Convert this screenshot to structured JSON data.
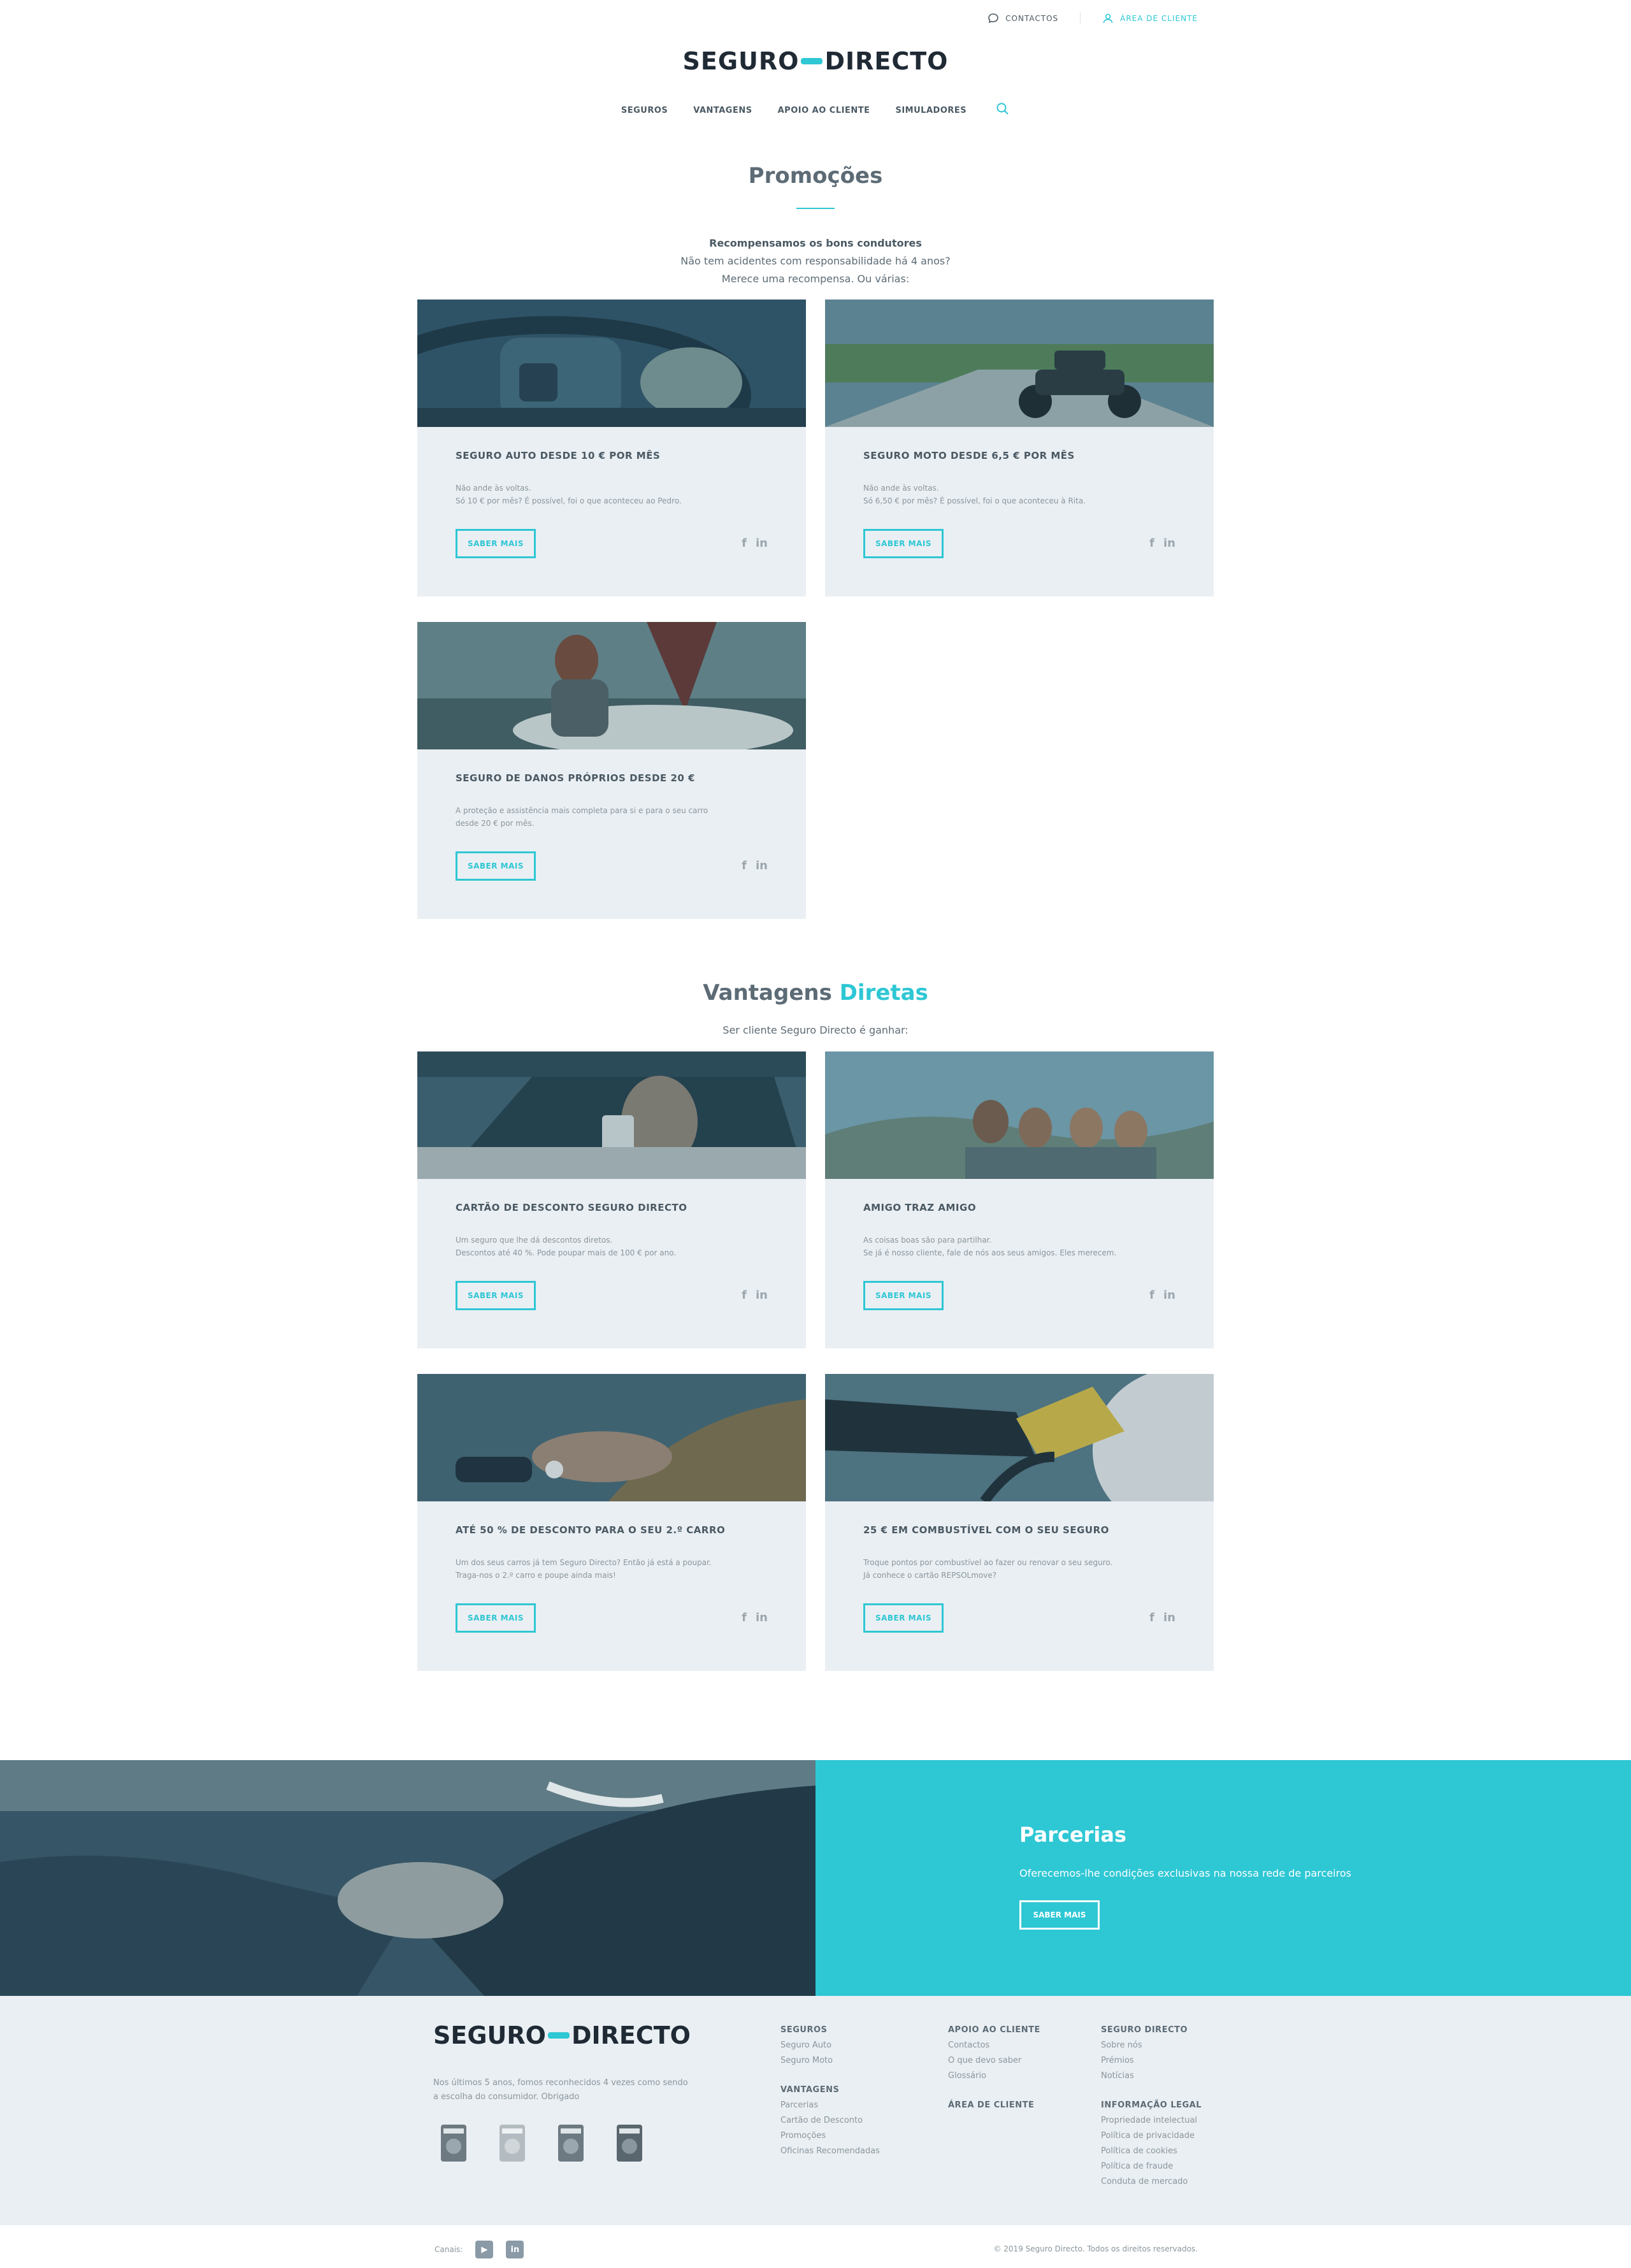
{
  "header": {
    "contacts_label": "CONTACTOS",
    "client_area_label": "ÁREA DE CLIENTE",
    "logo_left": "SEGURO",
    "logo_right": "DIRECTO"
  },
  "nav": {
    "items": [
      "SEGUROS",
      "VANTAGENS",
      "APOIO AO CLIENTE",
      "SIMULADORES"
    ]
  },
  "promocoes": {
    "title": "Promoções",
    "intro_bold": "Recompensamos os bons condutores",
    "intro_line2": "Não tem acidentes com responsabilidade há 4 anos?",
    "intro_line3": "Merece uma recompensa. Ou várias:",
    "cards": [
      {
        "title": "SEGURO AUTO DESDE 10 € POR MÊS",
        "line1": "Não ande às voltas.",
        "line2": "Só 10 € por mês? É possível, foi o que aconteceu ao Pedro.",
        "button": "SABER MAIS"
      },
      {
        "title": "SEGURO MOTO DESDE 6,5 € POR MÊS",
        "line1": "Não ande às voltas.",
        "line2": "Só 6,50 € por mês? É possível, foi o que aconteceu à Rita.",
        "button": "SABER MAIS"
      },
      {
        "title": "SEGURO DE DANOS PRÓPRIOS DESDE 20 €",
        "line1": "A proteção e assistência mais completa para si e para o seu carro",
        "line2": "desde 20 € por mês.",
        "button": "SABER MAIS"
      }
    ]
  },
  "vantagens": {
    "title_main": "Vantagens",
    "title_accent": "Diretas",
    "subtitle": "Ser cliente Seguro Directo é ganhar:",
    "cards": [
      {
        "title": "CARTÃO DE DESCONTO SEGURO DIRECTO",
        "line1": "Um seguro que lhe dá descontos diretos.",
        "line2": "Descontos até 40 %. Pode poupar mais de 100 € por ano.",
        "button": "SABER MAIS"
      },
      {
        "title": "AMIGO TRAZ AMIGO",
        "line1": "As coisas boas são para partilhar.",
        "line2": "Se já é nosso cliente, fale de nós aos seus amigos. Eles merecem.",
        "button": "SABER MAIS"
      },
      {
        "title": "ATÉ 50 % DE DESCONTO PARA O SEU 2.º CARRO",
        "line1": "Um dos seus carros já tem Seguro Directo? Então já está a poupar.",
        "line2": "Traga-nos o 2.º carro e poupe ainda mais!",
        "button": "SABER MAIS"
      },
      {
        "title": "25 € EM COMBUSTÍVEL COM O SEU SEGURO",
        "line1": "Troque pontos por combustível ao fazer ou renovar o seu seguro.",
        "line2": "Já conhece o cartão REPSOLmove?",
        "button": "SABER MAIS"
      }
    ]
  },
  "social": {
    "facebook": "f",
    "linkedin": "in"
  },
  "parcerias": {
    "title": "Parcerias",
    "text": "Oferecemos-lhe condições exclusivas na nossa rede de parceiros",
    "button": "SABER MAIS"
  },
  "footer": {
    "description_line1": "Nos últimos 5 anos, fomos reconhecidos 4 vezes como sendo",
    "description_line2": "a escolha do consumidor. Obrigado",
    "col1": {
      "heading1": "SEGUROS",
      "links1": [
        "Seguro Auto",
        "Seguro Moto"
      ],
      "heading2": "VANTAGENS",
      "links2": [
        "Parcerias",
        "Cartão de Desconto",
        "Promoções",
        "Oficinas Recomendadas"
      ]
    },
    "col2": {
      "heading1": "APOIO AO CLIENTE",
      "links1": [
        "Contactos",
        "O que devo saber",
        "Glossário"
      ],
      "heading2": "ÁREA DE CLIENTE"
    },
    "col3": {
      "heading1": "SEGURO DIRECTO",
      "links1": [
        "Sobre nós",
        "Prémios",
        "Notícias"
      ],
      "heading2": "INFORMAÇÃO LEGAL",
      "links2": [
        "Propriedade intelectual",
        "Política de privacidade",
        "Política de cookies",
        "Política de fraude",
        "Conduta de mercado"
      ]
    }
  },
  "bottom": {
    "channels_label": "Canais:",
    "youtube": "▶",
    "linkedin": "in",
    "copyright": "© 2019 Seguro Directo. Todos os direitos reservados."
  },
  "colors": {
    "accent": "#2ec7d4",
    "card_bg": "#eaeff3",
    "text": "#4a5963"
  }
}
